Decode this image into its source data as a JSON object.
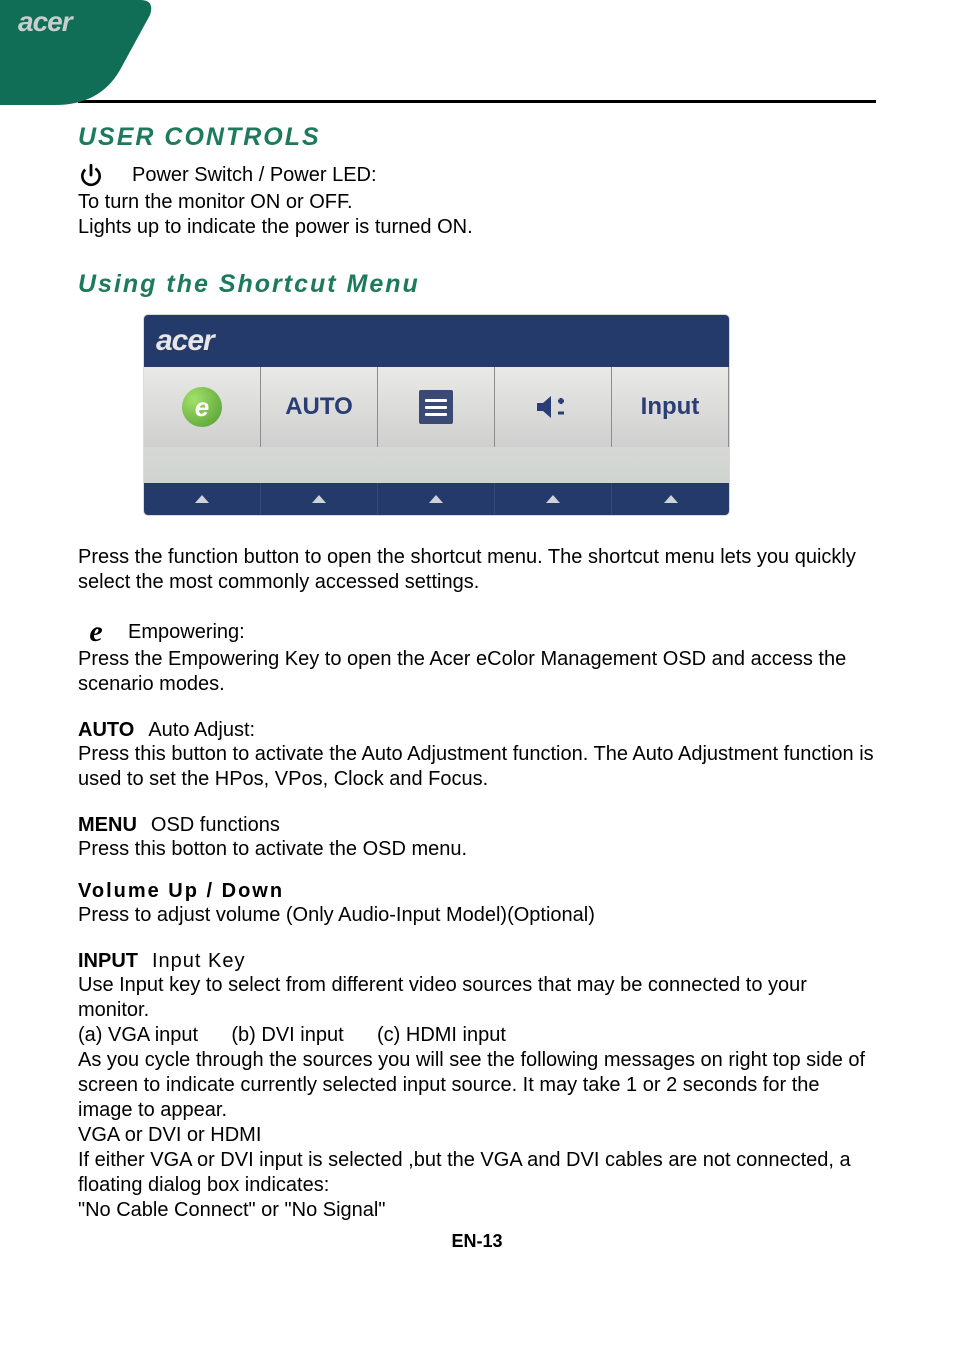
{
  "brand": "acer",
  "section_title": "USER CONTROLS",
  "power": {
    "title": "Power Switch / Power LED:",
    "line1": "To turn the monitor ON or OFF.",
    "line2": "Lights up to indicate the power is turned ON."
  },
  "shortcut_title": "Using  the Shortcut Menu",
  "osd": {
    "brand": "acer",
    "cells": {
      "auto": "AUTO",
      "input": "Input"
    }
  },
  "shortcut_para": "Press the function button to open the shortcut menu. The shortcut menu lets you quickly select the most commonly accessed settings.",
  "empowering": {
    "title": "Empowering:",
    "body": "Press the Empowering Key to open the Acer eColor Management OSD and access the scenario modes."
  },
  "auto": {
    "lead": "AUTO",
    "title": "Auto Adjust:",
    "body": "Press this button to activate the Auto Adjustment function. The Auto Adjustment function is used to set the HPos, VPos, Clock and Focus."
  },
  "menu": {
    "lead": "MENU",
    "title": "OSD functions",
    "body": "Press this botton to activate the OSD menu."
  },
  "volume": {
    "title": "Volume Up / Down",
    "body": " Press to adjust volume (Only Audio-Input Model)(Optional)"
  },
  "input": {
    "lead": "INPUT",
    "title": "Input Key",
    "body1": "Use Input key to select from different video sources that may be connected to your monitor.",
    "body2": "(a) VGA input      (b) DVI input      (c) HDMI input",
    "body3": "As you cycle through the sources you will see the following messages on right top side of screen to indicate currently selected input source. It may take 1 or 2 seconds for the image to appear.",
    "body4": "VGA  or  DVI  or  HDMI",
    "body5": "If either VGA or DVI input is selected ,but the VGA and DVI cables are not connected, a floating dialog box indicates:",
    "body6": "\"No Cable Connect\" or \"No Signal\""
  },
  "page_number": "EN-13"
}
